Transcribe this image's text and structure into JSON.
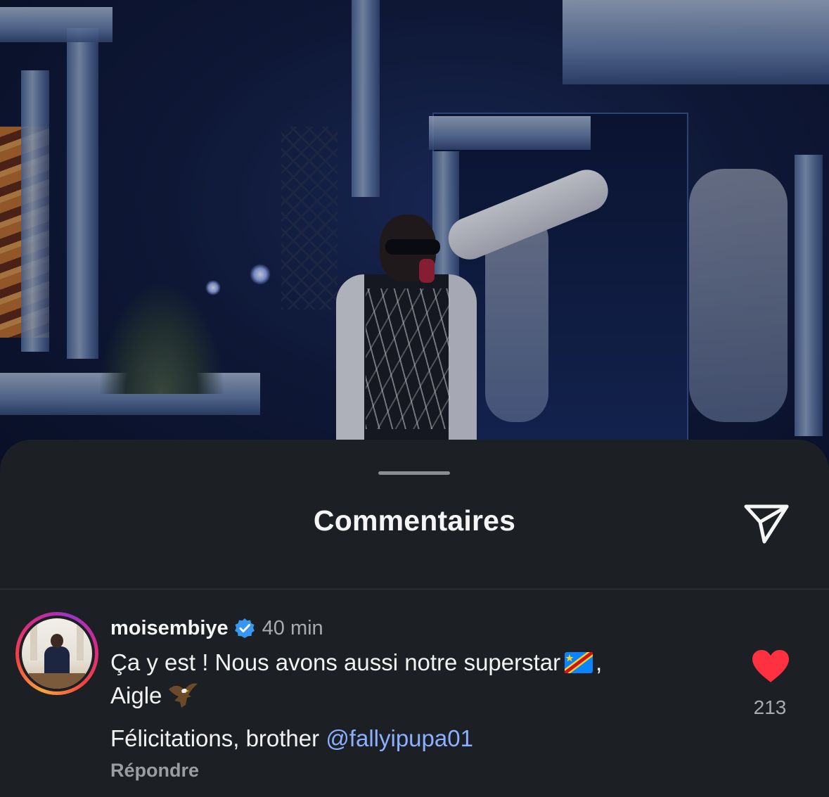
{
  "sheet": {
    "title": "Commentaires",
    "share_icon": "paper-plane-icon"
  },
  "comment": {
    "username": "moisembiye",
    "verified": true,
    "timestamp": "40 min",
    "line1_text": "Ça y est ! Nous avons aussi notre superstar",
    "line1_after_flag": ",",
    "line1_flag": "flag-dr-congo",
    "line1_continuation": "Aigle",
    "line1_emoji": "eagle",
    "line2_text": "Félicitations, brother",
    "line2_mention": "@fallyipupa01",
    "reply_label": "Répondre",
    "like_count": "213",
    "liked": true
  },
  "colors": {
    "sheet_bg": "#1c1f23",
    "like_red": "#ff3040",
    "mention_blue": "#8ab0ff",
    "verified_blue": "#3897f0"
  }
}
